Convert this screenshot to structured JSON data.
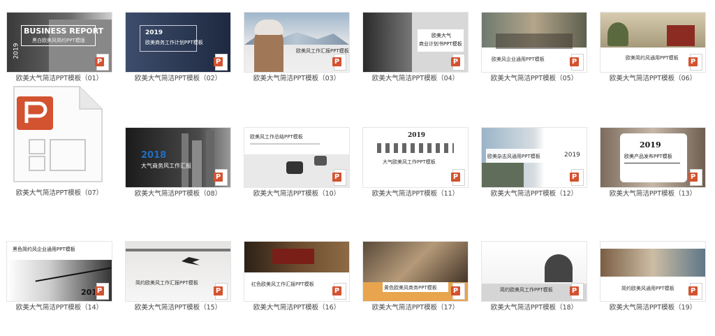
{
  "files": [
    {
      "caption": "欧美大气简洁PPT模板（01）",
      "title": "BUSINESS REPORT",
      "subtitle": "黑白欧美风简约PPT模版",
      "year": "2019"
    },
    {
      "caption": "欧美大气简洁PPT模板（02）",
      "title": "2019",
      "subtitle": "欧美商务工作计划PPT模板"
    },
    {
      "caption": "欧美大气简洁PPT模板（03）",
      "title": "欧美风工作汇报PPT模板"
    },
    {
      "caption": "欧美大气简洁PPT模板（04）",
      "title": "欧美大气",
      "subtitle": "商业计划书PPT模板"
    },
    {
      "caption": "欧美大气简洁PPT模板（05）",
      "title": "欧美风企业通用PPT模板"
    },
    {
      "caption": "欧美大气简洁PPT模板（06）",
      "title": "欧美简约风通用PPT模板"
    },
    {
      "caption": "欧美大气简洁PPT模板（07）"
    },
    {
      "caption": "欧美大气简洁PPT模板（08）",
      "title": "2018",
      "subtitle": "大气商务风工作汇报"
    },
    {
      "caption": "欧美大气简洁PPT模板（10）",
      "title": "欧美风工作总结PPT模板"
    },
    {
      "caption": "欧美大气简洁PPT模板（11）",
      "title": "2019",
      "subtitle": "大气欧美风工作PPT模板"
    },
    {
      "caption": "欧美大气简洁PPT模板（12）",
      "title": "欧美杂志风通用PPT模板",
      "year": "2019"
    },
    {
      "caption": "欧美大气简洁PPT模板（13）",
      "title": "2019",
      "subtitle": "欧美产品发布PPT模板"
    },
    {
      "caption": "欧美大气简洁PPT模板（14）",
      "title": "黑色简约风企业通用PPT模板",
      "year": "2019"
    },
    {
      "caption": "欧美大气简洁PPT模板（15）",
      "title": "简约欧美风工作汇报PPT模板"
    },
    {
      "caption": "欧美大气简洁PPT模板（16）",
      "title": "红色欧美风工作汇报PPT模板"
    },
    {
      "caption": "欧美大气简洁PPT模板（17）",
      "title": "黄色欧美风商务PPT模板"
    },
    {
      "caption": "欧美大气简洁PPT模板（18）",
      "title": "简约欧美风工作PPT模板"
    },
    {
      "caption": "欧美大气简洁PPT模板（19）",
      "title": "简约欧美风通用PPT模板"
    }
  ],
  "colors": {
    "accent": "#d35230",
    "blue": "#1f6fbf",
    "text": "#444444"
  },
  "icons": {
    "badge": "powerpoint-icon",
    "large": "powerpoint-file-icon"
  }
}
